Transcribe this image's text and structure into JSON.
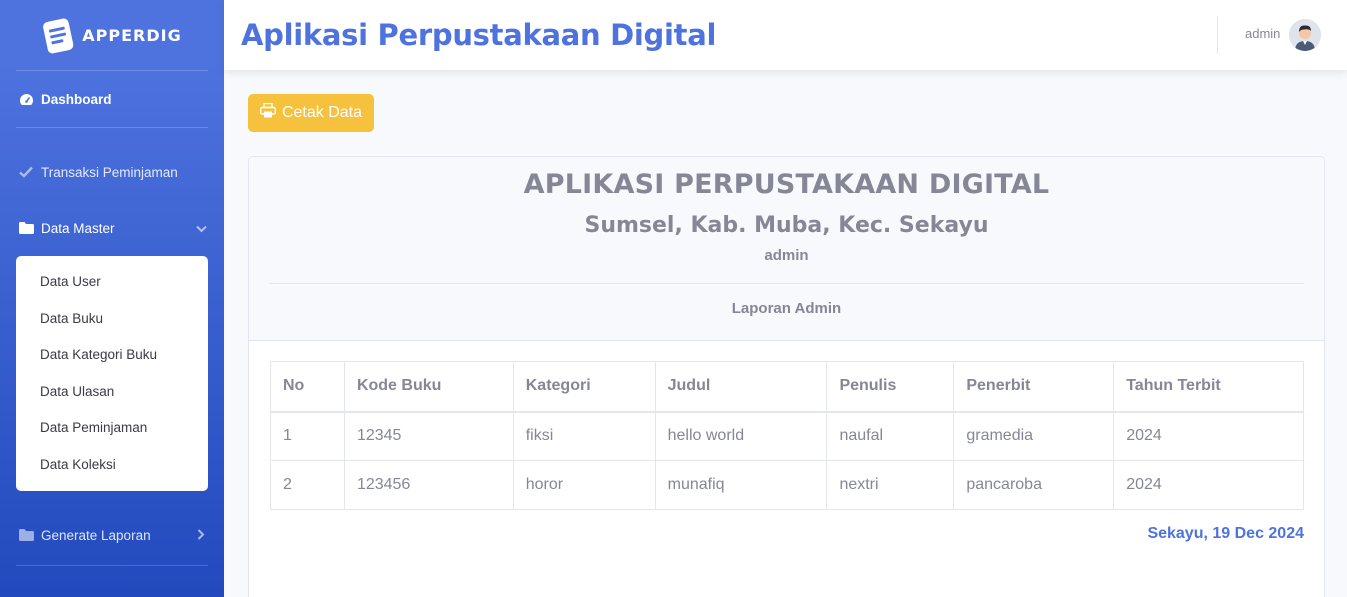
{
  "brand": {
    "name": "APPERDIG"
  },
  "sidebar": {
    "dashboard": "Dashboard",
    "transaksi": "Transaksi Peminjaman",
    "data_master": "Data Master",
    "data_master_items": [
      "Data User",
      "Data Buku",
      "Data Kategori Buku",
      "Data Ulasan",
      "Data Peminjaman",
      "Data Koleksi"
    ],
    "generate_laporan": "Generate Laporan"
  },
  "topbar": {
    "title": "Aplikasi Perpustakaan Digital",
    "user": "admin"
  },
  "actions": {
    "print_label": "Cetak Data"
  },
  "report": {
    "title": "APLIKASI PERPUSTAKAAN DIGITAL",
    "subtitle": "Sumsel, Kab. Muba, Kec. Sekayu",
    "user": "admin",
    "caption": "Laporan Admin",
    "date": "Sekayu, 19 Dec 2024"
  },
  "table": {
    "headers": [
      "No",
      "Kode Buku",
      "Kategori",
      "Judul",
      "Penulis",
      "Penerbit",
      "Tahun Terbit"
    ],
    "rows": [
      [
        "1",
        "12345",
        "fiksi",
        "hello world",
        "naufal",
        "gramedia",
        "2024"
      ],
      [
        "2",
        "123456",
        "horor",
        "munafiq",
        "nextri",
        "pancaroba",
        "2024"
      ]
    ]
  },
  "colors": {
    "primary": "#4e73df",
    "warning": "#f6c23e",
    "text_muted": "#858796"
  }
}
